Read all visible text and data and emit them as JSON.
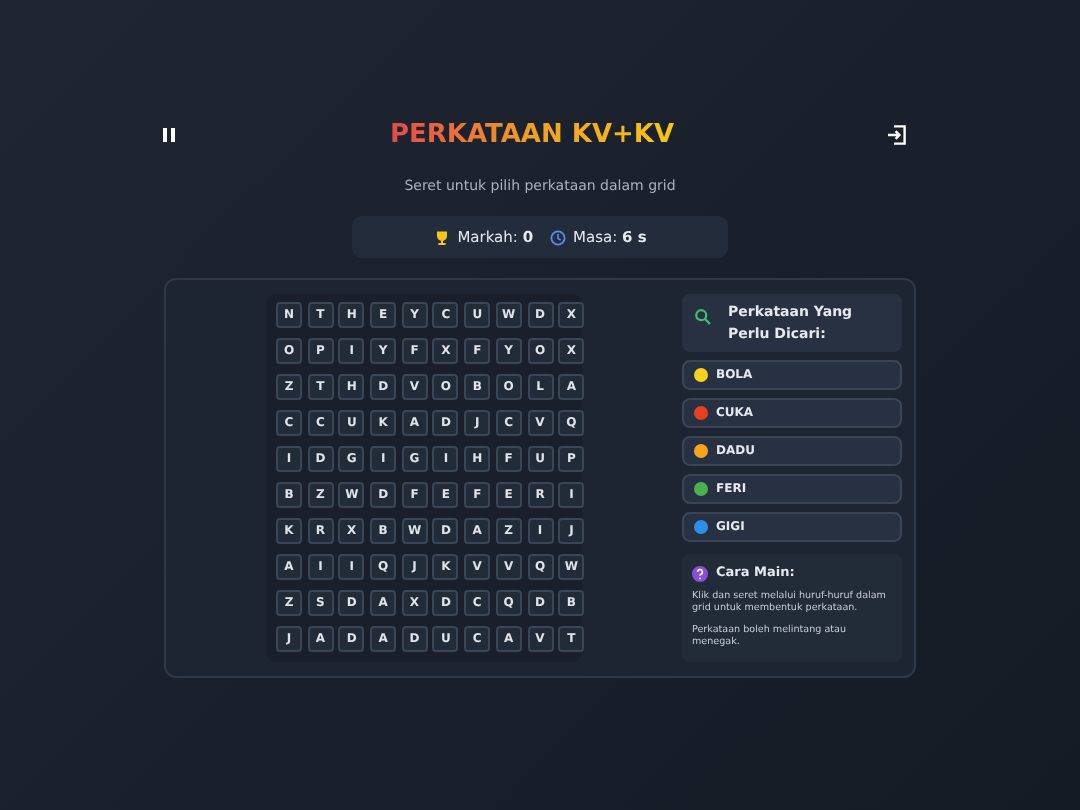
{
  "title": "PERKATAAN KV+KV",
  "subtitle": "Seret untuk pilih perkataan dalam grid",
  "stats": [
    {
      "kind": "score",
      "label": "Markah:",
      "value": "0"
    },
    {
      "kind": "time",
      "label": "Masa:",
      "value": "6 s"
    }
  ],
  "grid": [
    [
      "N",
      "T",
      "H",
      "E",
      "Y",
      "C",
      "U",
      "W",
      "D",
      "X"
    ],
    [
      "O",
      "P",
      "I",
      "Y",
      "F",
      "X",
      "F",
      "Y",
      "O",
      "X"
    ],
    [
      "Z",
      "T",
      "H",
      "D",
      "V",
      "O",
      "B",
      "O",
      "L",
      "A"
    ],
    [
      "C",
      "C",
      "U",
      "K",
      "A",
      "D",
      "J",
      "C",
      "V",
      "Q"
    ],
    [
      "I",
      "D",
      "G",
      "I",
      "G",
      "I",
      "H",
      "F",
      "U",
      "P"
    ],
    [
      "B",
      "Z",
      "W",
      "D",
      "F",
      "E",
      "F",
      "E",
      "R",
      "I"
    ],
    [
      "K",
      "R",
      "X",
      "B",
      "W",
      "D",
      "A",
      "Z",
      "I",
      "J"
    ],
    [
      "A",
      "I",
      "I",
      "Q",
      "J",
      "K",
      "V",
      "V",
      "Q",
      "W"
    ],
    [
      "Z",
      "S",
      "D",
      "A",
      "X",
      "D",
      "C",
      "Q",
      "D",
      "B"
    ],
    [
      "J",
      "A",
      "D",
      "A",
      "D",
      "U",
      "C",
      "A",
      "V",
      "T"
    ]
  ],
  "words_heading": "Perkataan Yang Perlu Dicari:",
  "words": [
    {
      "text": "BOLA",
      "color": "#f5d31c"
    },
    {
      "text": "CUKA",
      "color": "#e5401f"
    },
    {
      "text": "DADU",
      "color": "#f3a51c"
    },
    {
      "text": "FERI",
      "color": "#4caf50"
    },
    {
      "text": "GIGI",
      "color": "#2e8fe6"
    }
  ],
  "help": {
    "title": "Cara Main:",
    "paragraphs": [
      "Klik dan seret melalui huruf-huruf dalam grid untuk membentuk perkataan.",
      "Perkataan boleh melintang atau menegak."
    ]
  }
}
